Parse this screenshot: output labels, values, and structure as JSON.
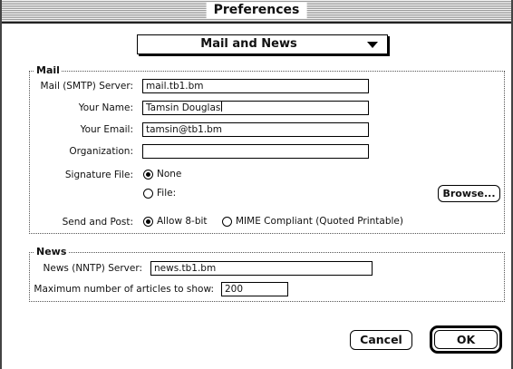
{
  "window": {
    "title": "Preferences"
  },
  "category_popup": {
    "selected": "Mail and News"
  },
  "mail": {
    "group_title": "Mail",
    "smtp_label": "Mail (SMTP) Server:",
    "smtp_value": "mail.tb1.bm",
    "name_label": "Your Name:",
    "name_value": "Tamsin Douglas",
    "email_label": "Your Email:",
    "email_value": "tamsin@tb1.bm",
    "org_label": "Organization:",
    "org_value": "",
    "signature_label": "Signature File:",
    "signature_none": "None",
    "signature_file": "File:",
    "browse_label": "Browse...",
    "send_label": "Send and Post:",
    "send_8bit": "Allow 8-bit",
    "send_mime": "MIME Compliant (Quoted Printable)"
  },
  "news": {
    "group_title": "News",
    "nntp_label": "News (NNTP) Server:",
    "nntp_value": "news.tb1.bm",
    "max_label": "Maximum number of articles to show:",
    "max_value": "200"
  },
  "buttons": {
    "cancel": "Cancel",
    "ok": "OK"
  }
}
